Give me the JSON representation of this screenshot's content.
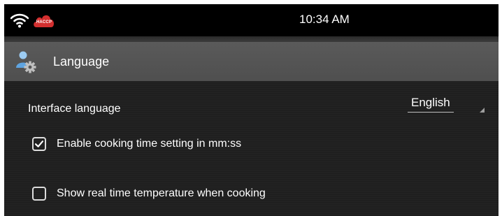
{
  "status_bar": {
    "time": "10:34 AM",
    "haccp_badge": "HACCP",
    "icons": [
      "wifi-icon",
      "cloud-icon"
    ]
  },
  "header": {
    "title": "Language",
    "icon": "user-settings-icon"
  },
  "settings": {
    "interface_language": {
      "label": "Interface language",
      "selected": "English"
    },
    "options": [
      {
        "label": "Enable cooking time setting in mm:ss",
        "checked": true
      },
      {
        "label": "Show real time temperature when cooking",
        "checked": false
      }
    ]
  },
  "colors": {
    "header_bg": "#555555",
    "content_bg": "#1f1f1f",
    "haccp_red": "#d32f2f",
    "text": "#ffffff"
  }
}
